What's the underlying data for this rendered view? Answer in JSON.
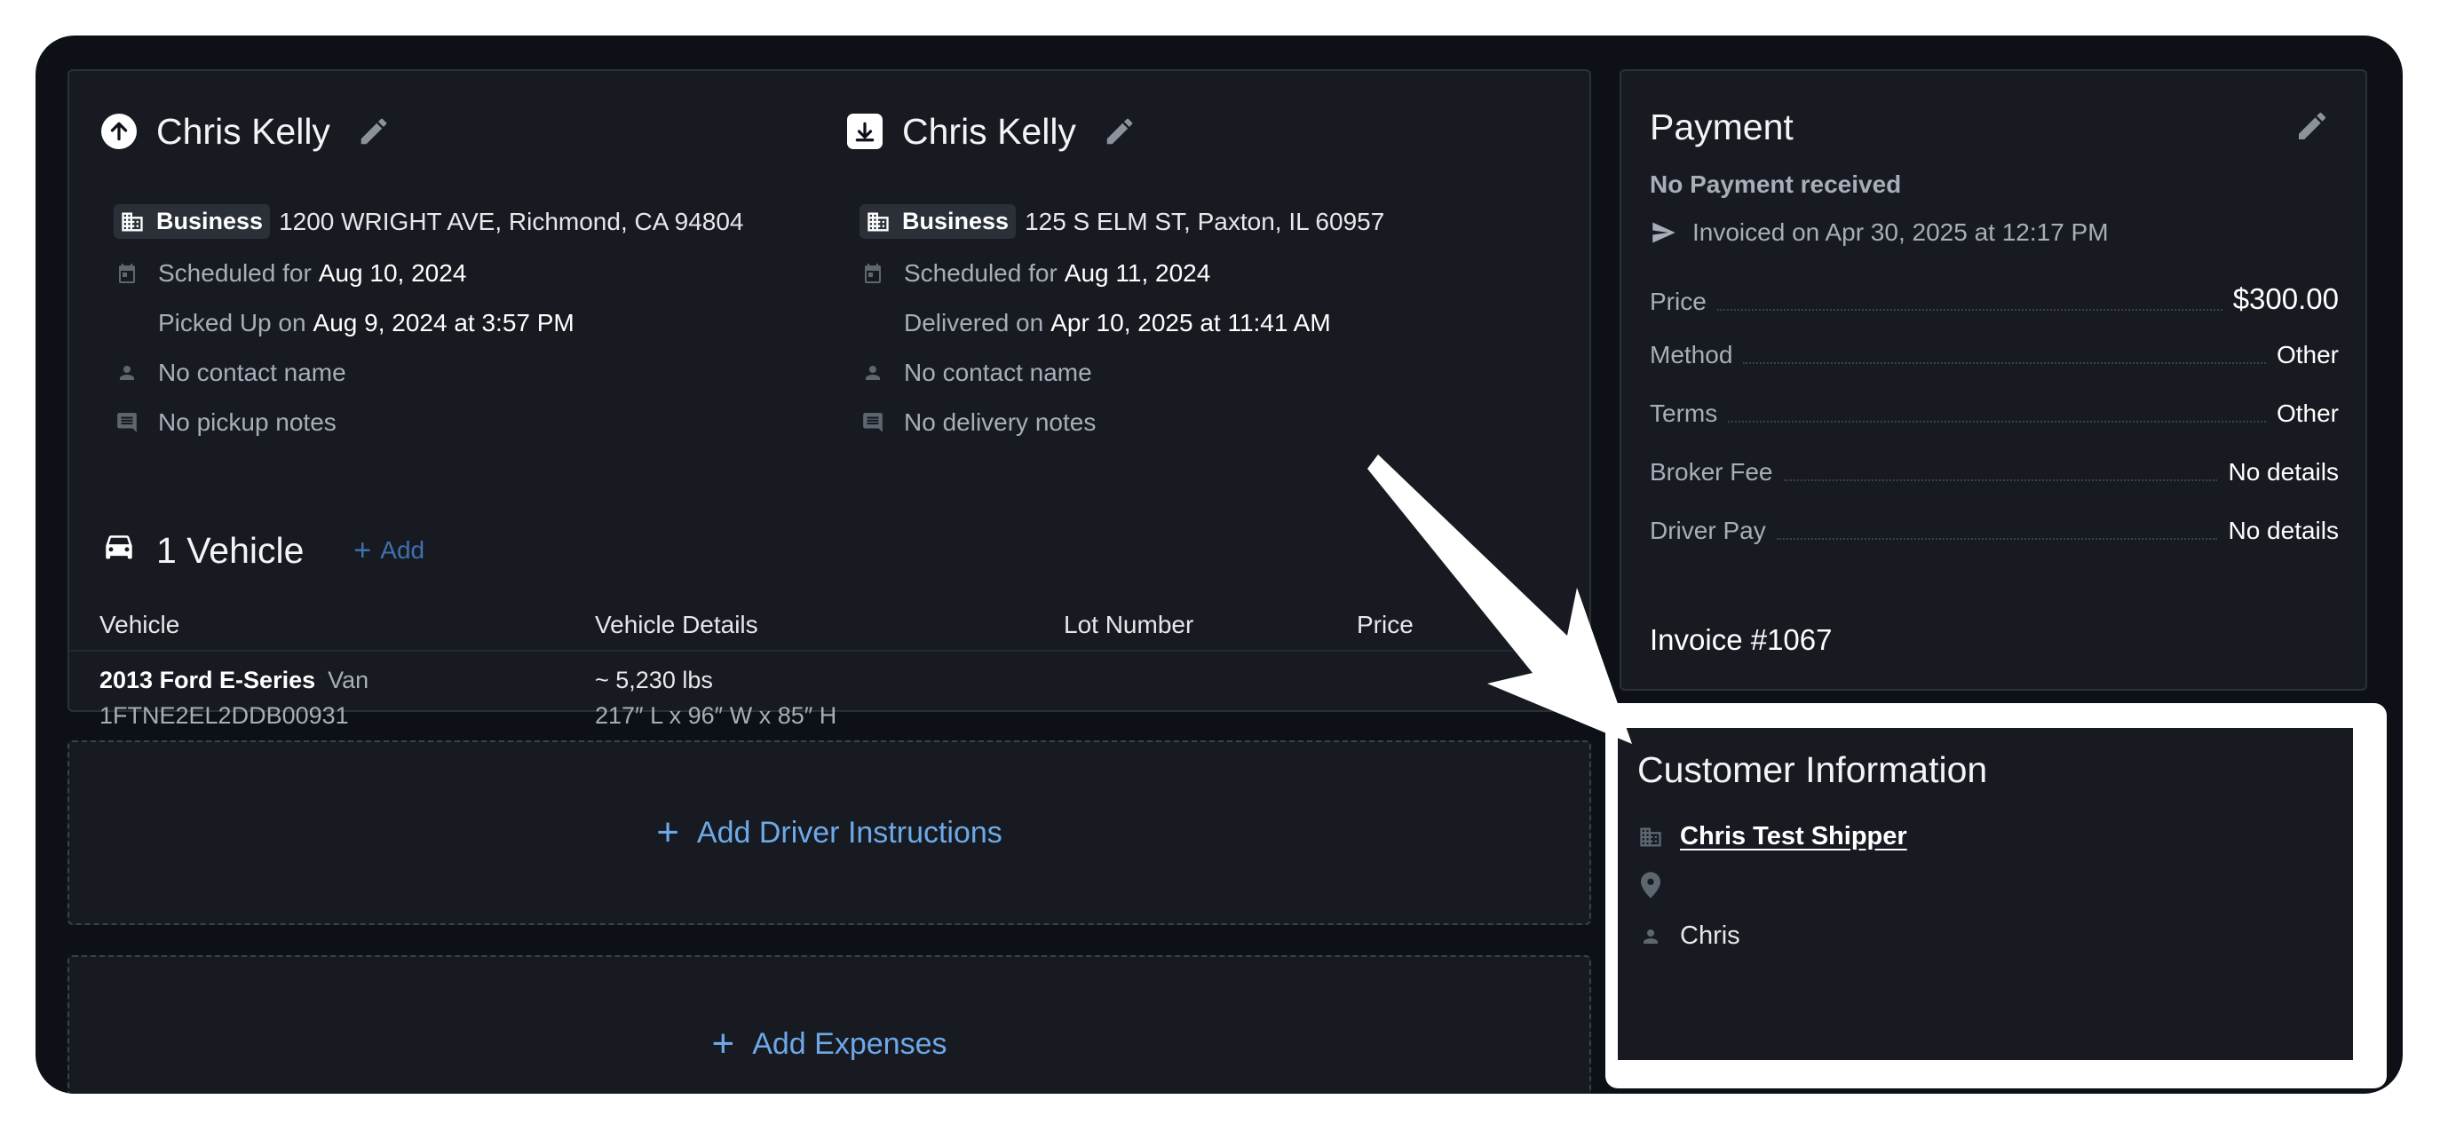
{
  "pickup": {
    "name": "Chris Kelly",
    "location_type": "Business",
    "address": "1200 WRIGHT AVE, Richmond, CA 94804",
    "scheduled_label": "Scheduled for",
    "scheduled_date": "Aug 10, 2024",
    "status_label": "Picked Up on",
    "status_date": "Aug 9, 2024 at 3:57 PM",
    "contact": "No contact name",
    "notes": "No pickup notes"
  },
  "delivery": {
    "name": "Chris Kelly",
    "location_type": "Business",
    "address": "125 S ELM ST, Paxton, IL 60957",
    "scheduled_label": "Scheduled for",
    "scheduled_date": "Aug 11, 2024",
    "status_label": "Delivered on",
    "status_date": "Apr 10, 2025 at 11:41 AM",
    "contact": "No contact name",
    "notes": "No delivery notes"
  },
  "vehicles": {
    "title": "1 Vehicle",
    "add_label": "Add",
    "columns": [
      "Vehicle",
      "Vehicle Details",
      "Lot Number",
      "Price"
    ],
    "rows": [
      {
        "name": "2013 Ford E-Series",
        "type": "Van",
        "vin": "1FTNE2EL2DDB00931",
        "weight": "~ 5,230 lbs",
        "dimensions": "217″ L x 96″ W x 85″ H"
      }
    ]
  },
  "actions": {
    "driver_instructions": "Add Driver Instructions",
    "expenses": "Add Expenses"
  },
  "payment": {
    "title": "Payment",
    "status": "No Payment received",
    "invoiced": "Invoiced on Apr 30, 2025 at 12:17 PM",
    "price_label": "Price",
    "price_value": "$300.00",
    "method_label": "Method",
    "method_value": "Other",
    "terms_label": "Terms",
    "terms_value": "Other",
    "broker_fee_label": "Broker Fee",
    "broker_fee_value": "No details",
    "driver_pay_label": "Driver Pay",
    "driver_pay_value": "No details",
    "invoice": "Invoice #1067"
  },
  "customer": {
    "title": "Customer Information",
    "company": "Chris Test Shipper",
    "address": "",
    "contact": "Chris"
  },
  "colors": {
    "background": "#0d1117",
    "card": "#171b21",
    "accent_link": "#6ea8e8",
    "highlight": "#ffffff"
  }
}
